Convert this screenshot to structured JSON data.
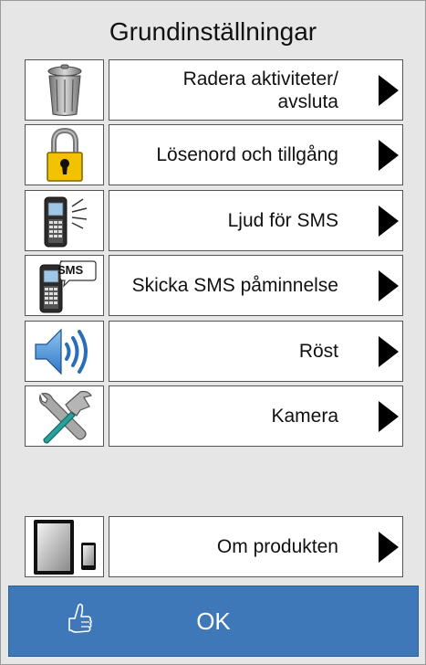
{
  "title": "Grundinställningar",
  "items": [
    {
      "label": "Radera aktiviteter/ avsluta",
      "icon": "trash-can-icon"
    },
    {
      "label": "Lösenord och tillgång",
      "icon": "padlock-icon"
    },
    {
      "label": "Ljud för SMS",
      "icon": "phone-ringing-icon"
    },
    {
      "label": "Skicka SMS påminnelse",
      "icon": "phone-sms-icon",
      "badge": "SMS"
    },
    {
      "label": "Röst",
      "icon": "speaker-icon"
    },
    {
      "label": "Kamera",
      "icon": "tools-icon"
    },
    {
      "label": "Om produkten",
      "icon": "tablet-phone-icon"
    }
  ],
  "ok": {
    "label": "OK",
    "icon": "thumbs-up-icon"
  },
  "colors": {
    "background": "#e6e6e6",
    "ok_bar": "#3f78b8",
    "arrow": "#000000"
  }
}
